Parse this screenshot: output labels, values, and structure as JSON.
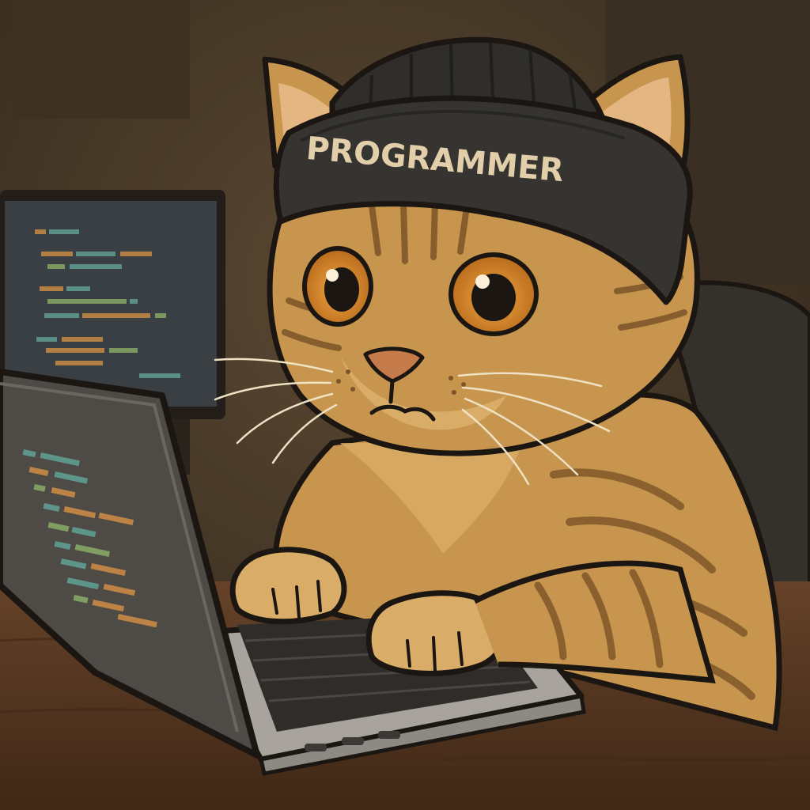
{
  "beanie": {
    "text": "PROGRAMMER"
  },
  "colors": {
    "wall": "#4a3b2a",
    "wall_dark": "#2e241a",
    "desk": "#5a3a22",
    "desk_dark": "#3f2816",
    "monitor_screen": "#3a3f44",
    "laptop_lid": "#4e4b47",
    "laptop_base": "#a8a49d",
    "keys": "#2f2d2a",
    "fur": "#c7954e",
    "fur_light": "#d9ad68",
    "fur_stripe": "#7b5428",
    "outline": "#1b1612",
    "beanie": "#2f2e2c",
    "beanie_text": "#e2cfaa",
    "eye_iris": "#d88a2a",
    "nose": "#c67b4a",
    "code_teal": "#5f9e93",
    "code_orange": "#c98a45",
    "code_green": "#86a766",
    "chair": "#34302b"
  }
}
